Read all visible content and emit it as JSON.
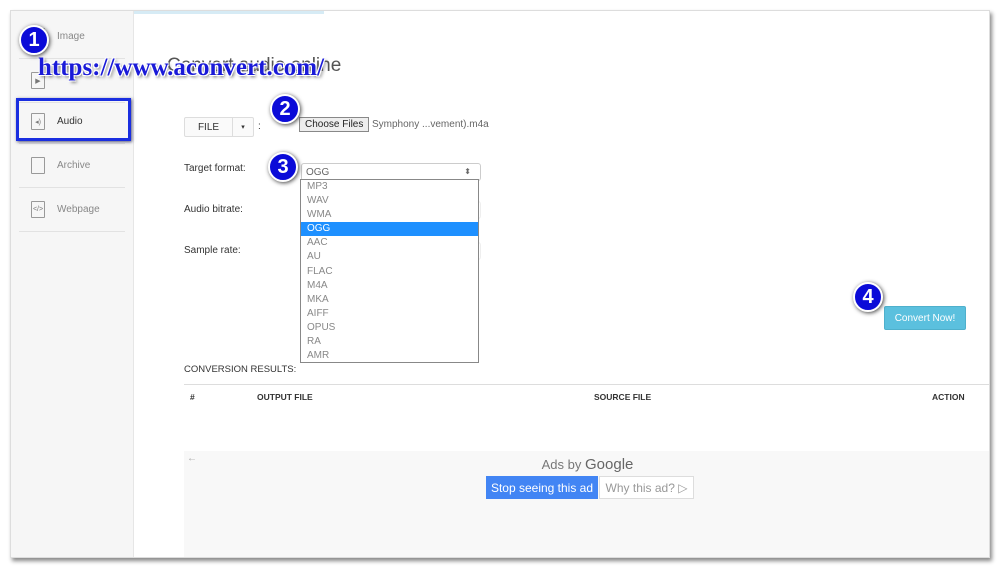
{
  "sidebar": {
    "items": [
      {
        "label": "Image",
        "icon": "image-file-icon"
      },
      {
        "label": "",
        "icon": "video-file-icon"
      },
      {
        "label": "Audio",
        "icon": "audio-file-icon",
        "active": true
      },
      {
        "label": "Archive",
        "icon": "archive-file-icon"
      },
      {
        "label": "Webpage",
        "icon": "webpage-file-icon"
      }
    ]
  },
  "page_title": "Convert audio online",
  "overlay_url": "https://www.aconvert.com/",
  "badges": [
    "1",
    "2",
    "3",
    "4"
  ],
  "file_button": {
    "label": "FILE",
    "caret": "▾",
    "colon": ":"
  },
  "choose_files": "Choose Files",
  "file_name": "Symphony ...vement).m4a",
  "target_format": {
    "label": "Target format:",
    "value": "OGG",
    "arrow": "⬍",
    "options": [
      "MP3",
      "WAV",
      "WMA",
      "OGG",
      "AAC",
      "AU",
      "FLAC",
      "M4A",
      "MKA",
      "AIFF",
      "OPUS",
      "RA",
      "AMR"
    ],
    "selected": "OGG"
  },
  "audio_bitrate_label": "Audio bitrate:",
  "sample_rate_label": "Sample rate:",
  "convert_button": "Convert Now!",
  "results": {
    "title": "CONVERSION RESULTS:",
    "columns": [
      "#",
      "OUTPUT FILE",
      "SOURCE FILE",
      "ACTION"
    ]
  },
  "ads": {
    "back": "←",
    "ads_by": "Ads by",
    "google": "Google",
    "stop": "Stop seeing this ad",
    "why": "Why this ad? ▷"
  },
  "colors": {
    "highlight": "#1a2ee0",
    "badge": "#0b0bd8",
    "convert": "#5bc0de",
    "selected_option": "#1e90ff",
    "ad_button": "#4285f4"
  }
}
